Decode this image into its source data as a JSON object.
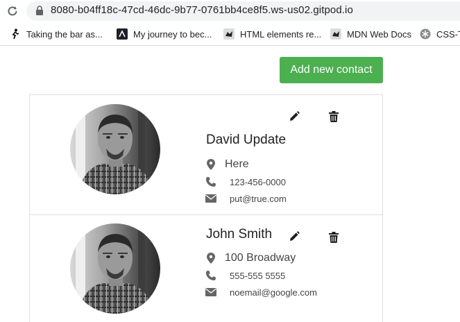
{
  "browser": {
    "url": "8080-b04ff18c-47cd-46dc-9b77-0761bb4ce8f5.ws-us02.gitpod.io",
    "bookmarks": [
      {
        "label": "Taking the bar as...",
        "icon": "runner-icon"
      },
      {
        "label": "My journey to bec...",
        "icon": "app-icon"
      },
      {
        "label": "HTML elements re...",
        "icon": "mdn-icon"
      },
      {
        "label": "MDN Web Docs",
        "icon": "mdn-icon"
      },
      {
        "label": "CSS-T",
        "icon": "snowflake-icon"
      }
    ]
  },
  "toolbar": {
    "add_label": "Add new contact"
  },
  "contacts": [
    {
      "name": "David Update",
      "address": "Here",
      "phone": "123-456-0000",
      "email": "put@true.com"
    },
    {
      "name": "John Smith",
      "address": "100 Broadway",
      "phone": "555-555 5555",
      "email": "noemail@google.com"
    }
  ],
  "colors": {
    "accent": "#4caf50",
    "icon": "#666666"
  }
}
